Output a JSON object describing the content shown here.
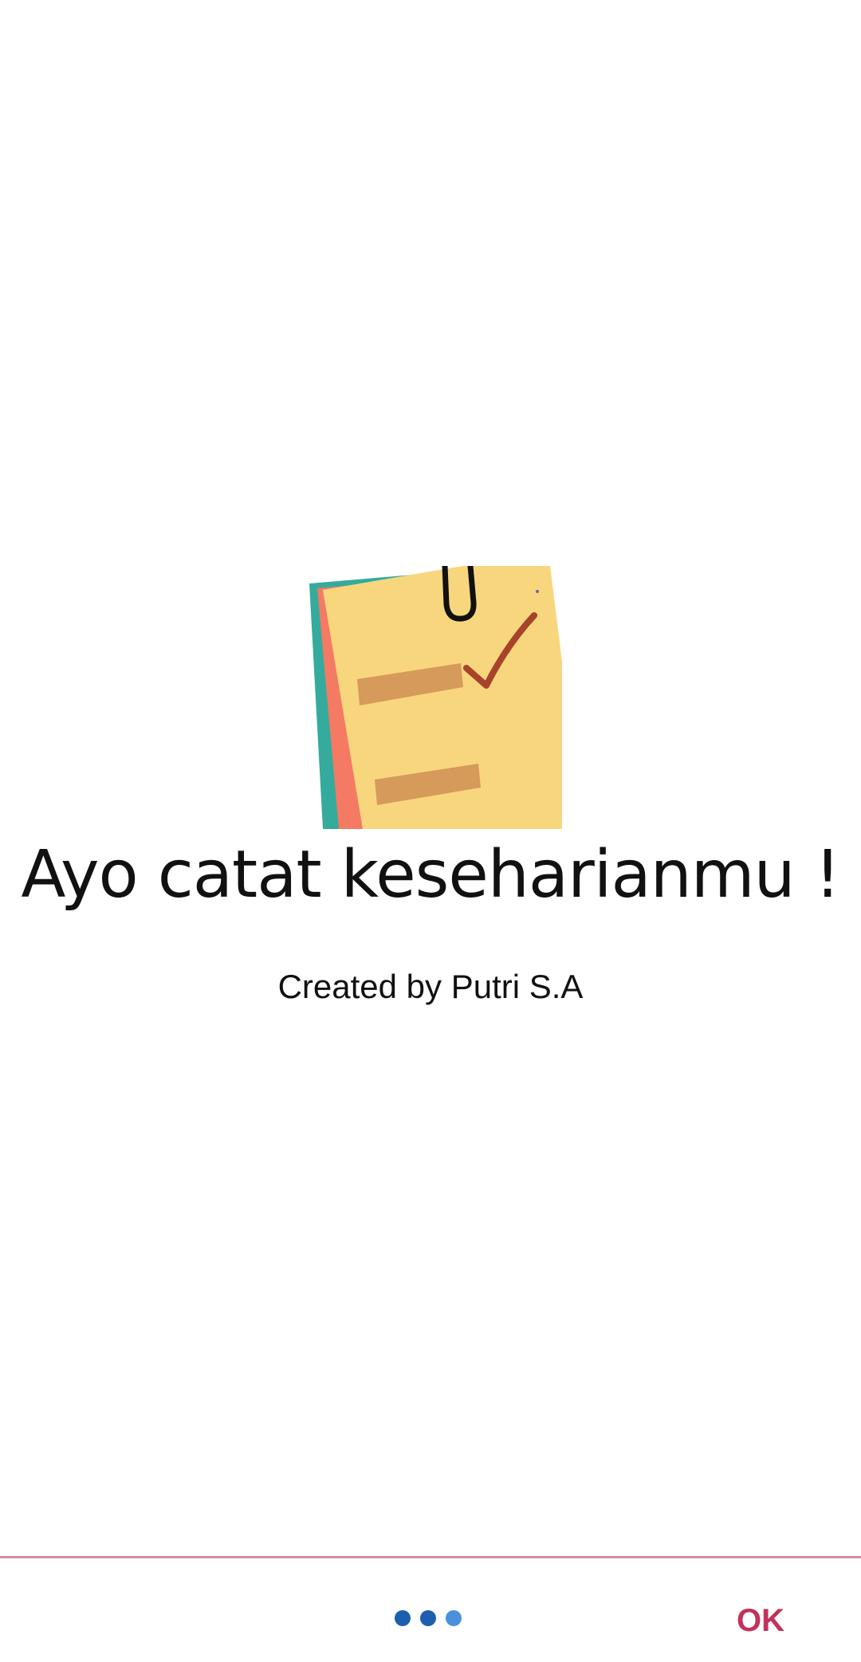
{
  "onboarding": {
    "headline": "Ayo catat keseharianmu !",
    "credit": "Created by Putri S.A",
    "illustration_icon": "notepad-checklist-icon"
  },
  "pager": {
    "total_pages": 3,
    "current_page": 3
  },
  "bottom_bar": {
    "ok_label": "OK"
  },
  "colors": {
    "accent": "#c2325a",
    "divider": "#d48aa0",
    "dot_active": "#1d5fae",
    "dot_inactive": "#4b90dc",
    "note_yellow": "#f8d67e",
    "note_teal": "#34ab9c",
    "note_coral": "#f47a63"
  }
}
